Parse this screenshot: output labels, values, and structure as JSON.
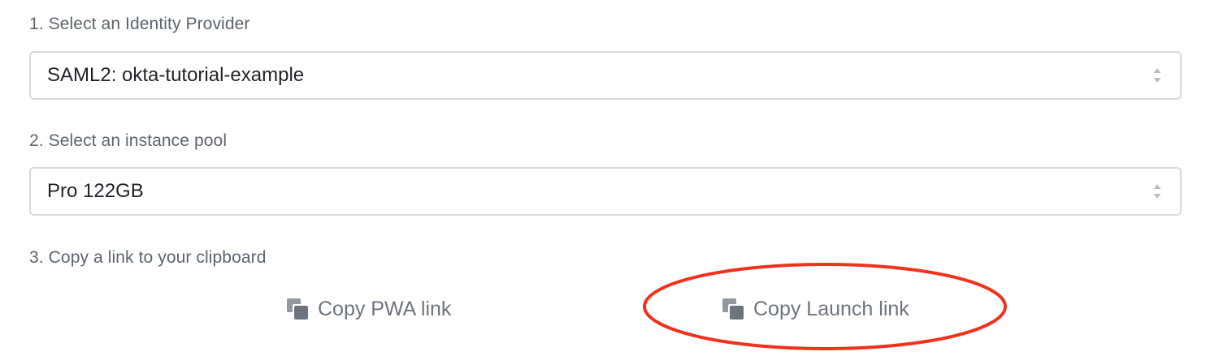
{
  "steps": {
    "identity_provider": {
      "label": "1. Select an Identity Provider",
      "selected_value": "SAML2: okta-tutorial-example"
    },
    "instance_pool": {
      "label": "2. Select an instance pool",
      "selected_value": "Pro 122GB"
    },
    "copy_link": {
      "label": "3. Copy a link to your clipboard",
      "pwa_button_label": "Copy PWA link",
      "launch_button_label": "Copy Launch link"
    }
  },
  "icons": {
    "select_arrows": "chevron-up-down-icon",
    "copy": "copy-icon"
  },
  "colors": {
    "label_text": "#5c6470",
    "value_text": "#1f2329",
    "link_text": "#6d7480",
    "icon": "#6d7480",
    "border": "#d6d9dd",
    "annotation": "#f0321e"
  }
}
